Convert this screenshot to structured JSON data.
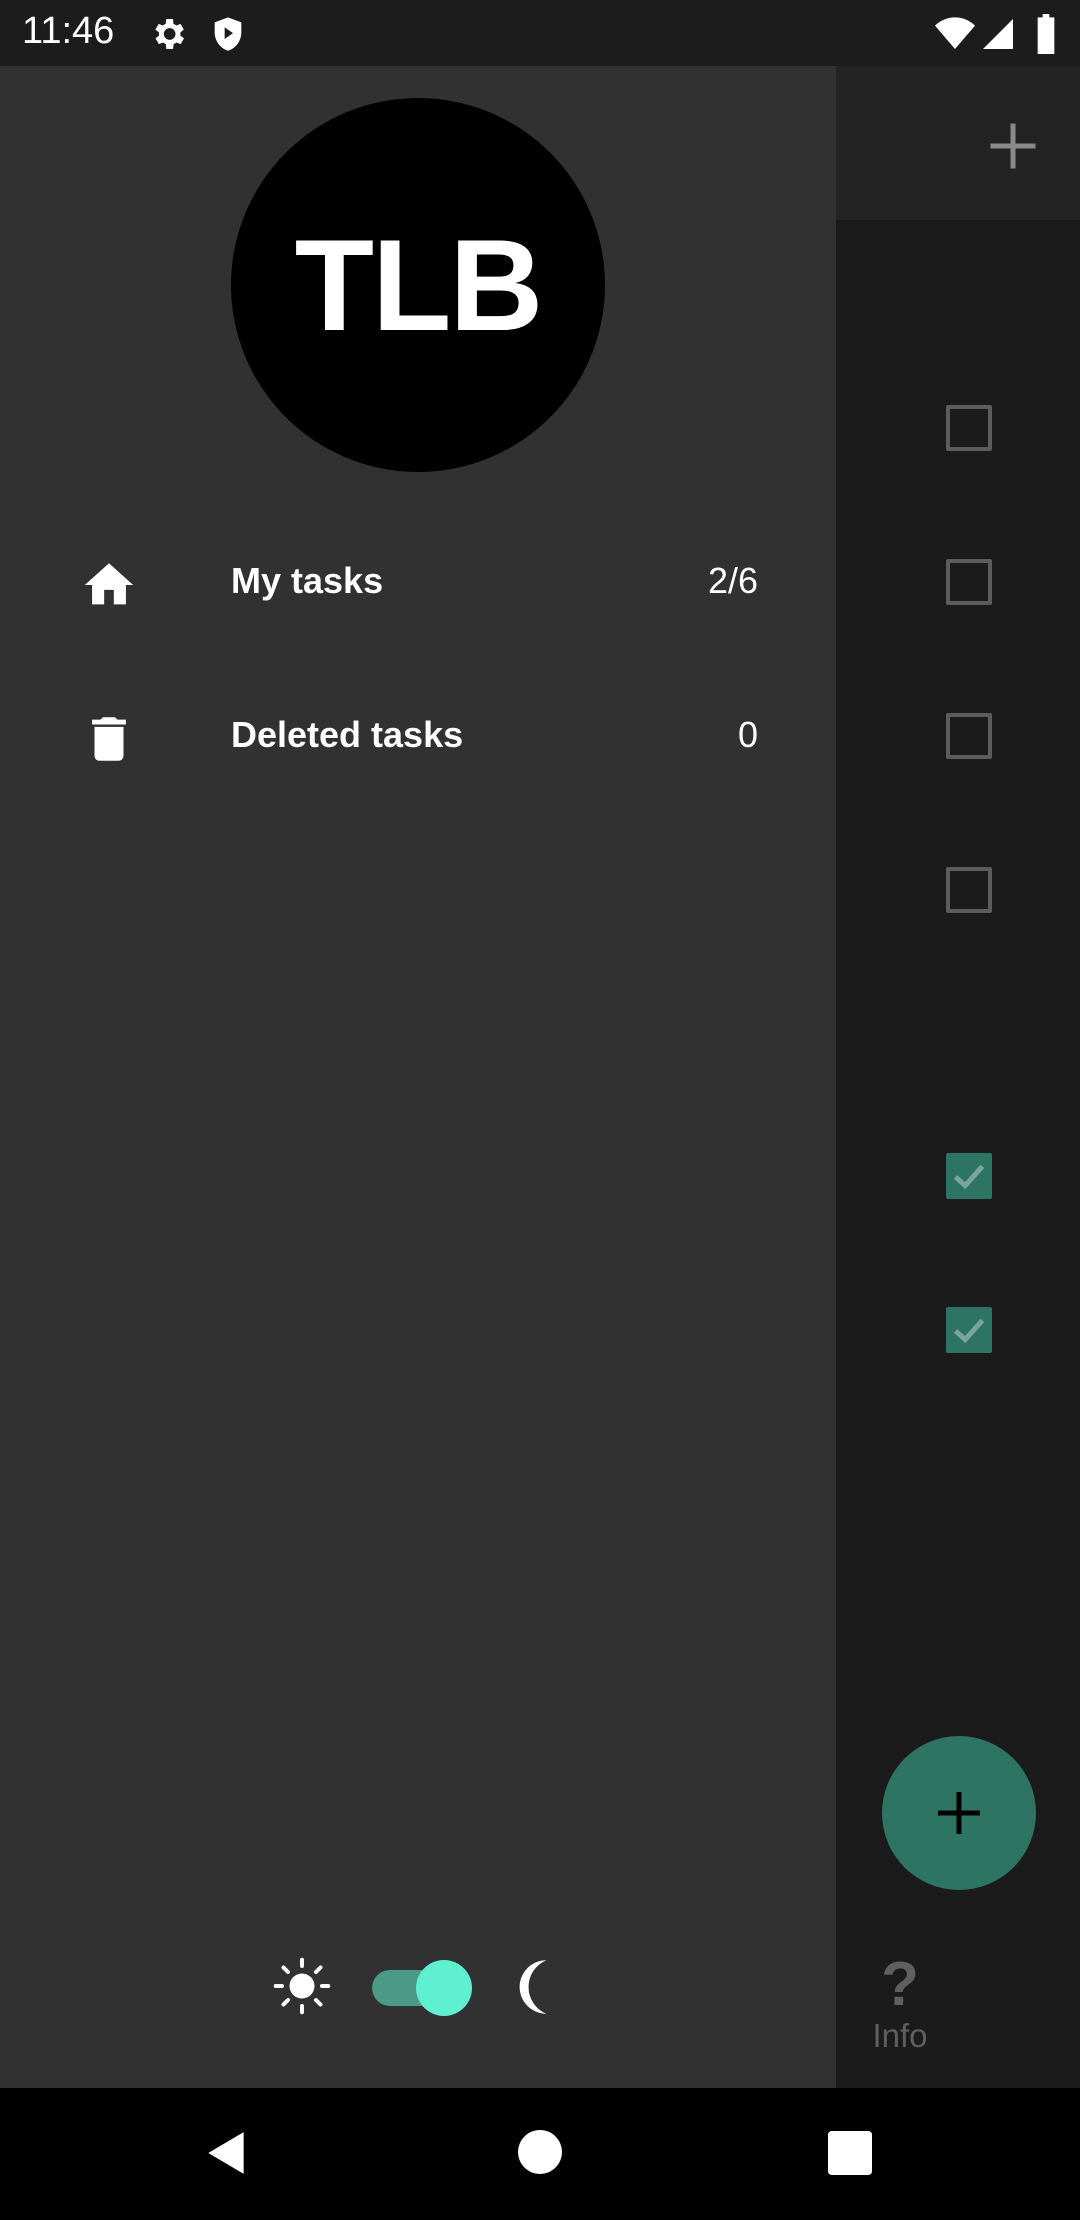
{
  "status_bar": {
    "time": "11:46"
  },
  "drawer": {
    "avatar_initials": "TLB",
    "items": [
      {
        "label": "My tasks",
        "count": "2/6",
        "icon": "home-icon"
      },
      {
        "label": "Deleted tasks",
        "count": "0",
        "icon": "trash-icon"
      }
    ],
    "theme_toggle": {
      "dark_mode": true
    }
  },
  "main": {
    "tasks": [
      {
        "checked": false
      },
      {
        "checked": false
      },
      {
        "checked": false
      },
      {
        "checked": false
      },
      {
        "checked": true
      },
      {
        "checked": true
      }
    ],
    "info_label": "Info",
    "info_symbol": "?"
  },
  "colors": {
    "accent": "#2e7463",
    "switch_thumb": "#5ff0d2",
    "drawer_bg": "#313131"
  }
}
